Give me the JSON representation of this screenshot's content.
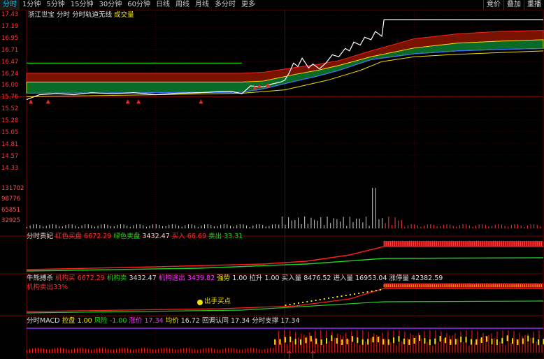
{
  "tabs": [
    "分时",
    "1分钟",
    "5分钟",
    "15分钟",
    "30分钟",
    "60分钟",
    "日线",
    "周线",
    "月线",
    "多分时",
    "更多"
  ],
  "active_tab": 0,
  "top_right": [
    "竞价",
    "叠加",
    "重播"
  ],
  "price_axis": [
    "17.43",
    "17.19",
    "16.95",
    "16.71",
    "16.47",
    "16.24",
    "16.00",
    "15.76",
    "15.52",
    "15.28",
    "15.05",
    "14.81",
    "14.57",
    "14.33"
  ],
  "volume_axis": [
    "131702",
    "98776",
    "65851",
    "32925"
  ],
  "main_title": {
    "stock": "浙江世宝",
    "a": "分时",
    "b": "分时轨道无线",
    "vol": "成交量"
  },
  "panel1": {
    "name": "分时贵妃",
    "red_label": "红色买盘",
    "red_val": "6672.29",
    "green_label": "绿色卖盘",
    "green_val": "3432.47",
    "buy_label": "买入",
    "buy_val": "66.69",
    "sell_label": "卖出",
    "sell_val": "33.31"
  },
  "panel2": {
    "name": "牛熊搏杀",
    "jgm_label": "机构买",
    "jgm_val": "6672.29",
    "jgs_label": "机构卖",
    "jgs_val": "3432.47",
    "jgtc_label": "机构逃出",
    "jgtc_val": "3439.82",
    "qs_label": "强势",
    "qs_val": "1.00",
    "ls_label": "拉升",
    "ls_val": "1.00",
    "mrl_label": "买入量",
    "mrl_val": "8476.52",
    "jcl_label": "进入量",
    "jcl_val": "16953.04",
    "zzl_label": "涨停量",
    "zzl_val": "42382.59",
    "sub": "机构卖出33%",
    "marker": "出手买点"
  },
  "panel3": {
    "name": "分时MACD",
    "kp_label": "控盘",
    "kp_val": "1.00",
    "fx_label": "风险",
    "fx_val": "-1.00",
    "zj_label": "涨价",
    "zj_val": "17.34",
    "jj_label": "均价",
    "jj_val": "16.72",
    "hc_label": "回调认同",
    "hc_val": "17.34",
    "zc_label": "分时支撑",
    "zc_val": "17.34"
  },
  "chart_data": {
    "type": "line",
    "price_range": [
      14.33,
      17.43
    ],
    "prev_close": 15.76,
    "limit_up": 17.34,
    "price_points": [
      [
        0,
        15.7
      ],
      [
        6,
        15.8
      ],
      [
        14,
        15.82
      ],
      [
        22,
        15.8
      ],
      [
        30,
        15.84
      ],
      [
        40,
        15.82
      ],
      [
        50,
        15.84
      ],
      [
        60,
        15.8
      ],
      [
        70,
        15.83
      ],
      [
        80,
        15.84
      ],
      [
        88,
        15.86
      ],
      [
        95,
        15.87
      ],
      [
        100,
        15.82
      ],
      [
        104,
        15.98
      ],
      [
        110,
        15.96
      ],
      [
        114,
        16.02
      ],
      [
        118,
        16.06
      ],
      [
        120,
        16.1
      ],
      [
        122,
        16.25
      ],
      [
        124,
        16.45
      ],
      [
        126,
        16.38
      ],
      [
        128,
        16.55
      ],
      [
        131,
        16.35
      ],
      [
        133,
        16.43
      ],
      [
        136,
        16.33
      ],
      [
        139,
        16.45
      ],
      [
        142,
        16.62
      ],
      [
        145,
        16.58
      ],
      [
        148,
        16.75
      ],
      [
        150,
        16.7
      ],
      [
        152,
        16.88
      ],
      [
        155,
        16.82
      ],
      [
        157,
        16.98
      ],
      [
        160,
        16.93
      ],
      [
        162,
        17.1
      ],
      [
        165,
        17.0
      ],
      [
        166,
        17.34
      ],
      [
        240,
        17.34
      ]
    ],
    "avg_points": [
      [
        0,
        15.76
      ],
      [
        60,
        15.8
      ],
      [
        100,
        15.83
      ],
      [
        120,
        15.9
      ],
      [
        140,
        16.1
      ],
      [
        155,
        16.3
      ],
      [
        165,
        16.48
      ],
      [
        180,
        16.58
      ],
      [
        200,
        16.63
      ],
      [
        240,
        16.7
      ]
    ]
  }
}
